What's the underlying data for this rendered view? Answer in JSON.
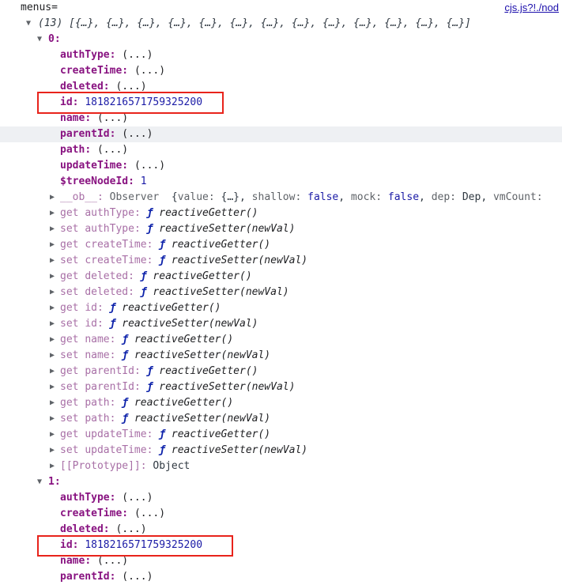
{
  "header": {
    "label": "menus=",
    "source_link": "cjs.js?!./nod"
  },
  "summary": {
    "count": "(13)",
    "items": "[{…}, {…}, {…}, {…}, {…}, {…}, {…}, {…}, {…}, {…}, {…}, {…}, {…}]"
  },
  "item0": {
    "index_label": "0:",
    "collapsed": {
      "authType": "authType",
      "createTime": "createTime",
      "deleted": "deleted",
      "name": "name",
      "parentId": "parentId",
      "path": "path",
      "updateTime": "updateTime",
      "ellipsis": "(...)"
    },
    "id_key": "id",
    "id_value": "1818216571759325200",
    "tree_key": "$treeNodeId",
    "tree_value": "1",
    "ob": {
      "key": "__ob__",
      "type": "Observer",
      "value_key": "value",
      "value_val": "{…}",
      "shallow_key": "shallow",
      "shallow_val": "false",
      "mock_key": "mock",
      "mock_val": "false",
      "dep_key": "dep",
      "dep_val": "Dep",
      "vmcount_key": "vmCount"
    },
    "accessors": [
      {
        "prefix": "get",
        "name": "authType",
        "fn": "reactiveGetter()"
      },
      {
        "prefix": "set",
        "name": "authType",
        "fn": "reactiveSetter(newVal)"
      },
      {
        "prefix": "get",
        "name": "createTime",
        "fn": "reactiveGetter()"
      },
      {
        "prefix": "set",
        "name": "createTime",
        "fn": "reactiveSetter(newVal)"
      },
      {
        "prefix": "get",
        "name": "deleted",
        "fn": "reactiveGetter()"
      },
      {
        "prefix": "set",
        "name": "deleted",
        "fn": "reactiveSetter(newVal)"
      },
      {
        "prefix": "get",
        "name": "id",
        "fn": "reactiveGetter()"
      },
      {
        "prefix": "set",
        "name": "id",
        "fn": "reactiveSetter(newVal)"
      },
      {
        "prefix": "get",
        "name": "name",
        "fn": "reactiveGetter()"
      },
      {
        "prefix": "set",
        "name": "name",
        "fn": "reactiveSetter(newVal)"
      },
      {
        "prefix": "get",
        "name": "parentId",
        "fn": "reactiveGetter()"
      },
      {
        "prefix": "set",
        "name": "parentId",
        "fn": "reactiveSetter(newVal)"
      },
      {
        "prefix": "get",
        "name": "path",
        "fn": "reactiveGetter()"
      },
      {
        "prefix": "set",
        "name": "path",
        "fn": "reactiveSetter(newVal)"
      },
      {
        "prefix": "get",
        "name": "updateTime",
        "fn": "reactiveGetter()"
      },
      {
        "prefix": "set",
        "name": "updateTime",
        "fn": "reactiveSetter(newVal)"
      }
    ],
    "prototype": {
      "key": "[[Prototype]]",
      "value": "Object"
    }
  },
  "item1": {
    "index_label": "1:",
    "authType": "authType",
    "createTime": "createTime",
    "deleted": "deleted",
    "id_key": "id",
    "id_value": "1818216571759325200",
    "name": "name",
    "parentId": "parentId",
    "ellipsis": "(...)"
  },
  "glyphs": {
    "f": "ƒ",
    "collapsed": "▶",
    "expanded": "▼"
  },
  "colors": {
    "highlight_box": "#e8231b",
    "key": "#881280",
    "number": "#1a1aa6"
  }
}
